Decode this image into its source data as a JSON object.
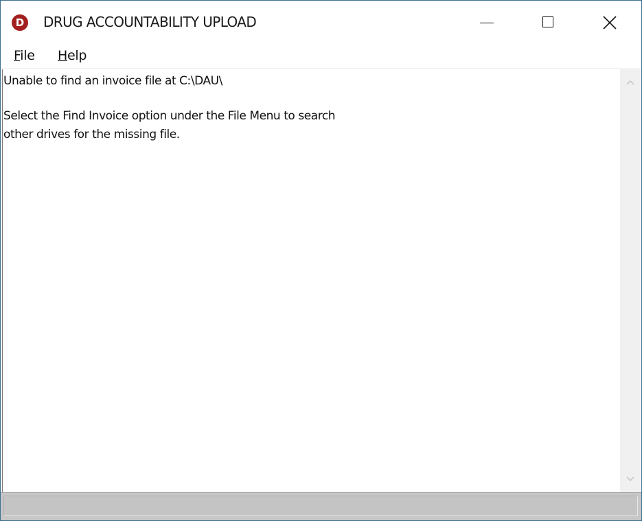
{
  "window": {
    "title": "DRUG ACCOUNTABILITY UPLOAD",
    "icon_letter": "D",
    "icon_color": "#a31f1f"
  },
  "menubar": {
    "file": {
      "accel": "F",
      "rest": "ile"
    },
    "help": {
      "accel": "H",
      "rest": "elp"
    }
  },
  "content": {
    "line1": "Unable to find an invoice file at C:\\DAU\\",
    "line2": "Select the Find Invoice option under the File Menu to search",
    "line3": "other drives for the missing file."
  },
  "statusbar": {
    "text": ""
  }
}
